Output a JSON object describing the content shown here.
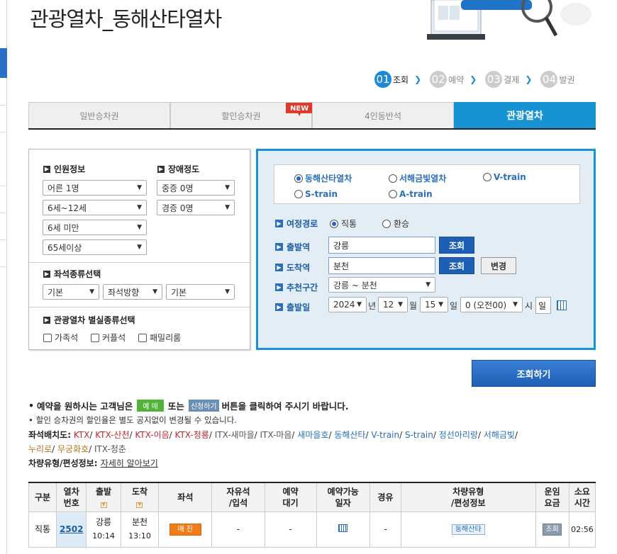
{
  "page_title": "관광열차_동해산타열차",
  "steps": [
    {
      "num": "01",
      "label": "조회",
      "active": true
    },
    {
      "num": "02",
      "label": "예약",
      "active": false
    },
    {
      "num": "03",
      "label": "결제",
      "active": false
    },
    {
      "num": "04",
      "label": "발권",
      "active": false
    }
  ],
  "tabs": [
    {
      "label": "일반승차권",
      "active": false
    },
    {
      "label": "할인승차권",
      "active": false,
      "badge": "NEW"
    },
    {
      "label": "4인동반석",
      "active": false
    },
    {
      "label": "관광열차",
      "active": true
    }
  ],
  "passenger": {
    "title": "인원정보",
    "selects": [
      "어른 1명",
      "6세~12세",
      "6세 미만",
      "65세이상"
    ]
  },
  "disability": {
    "title": "장애정도",
    "selects": [
      "중증 0명",
      "경증 0명"
    ]
  },
  "seat_type": {
    "title": "좌석종류선택",
    "selects": [
      "기본",
      "좌석방향",
      "기본"
    ]
  },
  "room_type": {
    "title": "관광열차 별실종류선택",
    "checkboxes": [
      "가족석",
      "커플석",
      "패밀리룸"
    ]
  },
  "trains": [
    {
      "label": "동해산타열차",
      "checked": true
    },
    {
      "label": "서해금빛열차",
      "checked": false
    },
    {
      "label": "V-train",
      "checked": false
    },
    {
      "label": "S-train",
      "checked": false
    },
    {
      "label": "A-train",
      "checked": false
    }
  ],
  "route": {
    "label": "여정경로",
    "options": [
      {
        "label": "직통",
        "checked": true
      },
      {
        "label": "환승",
        "checked": false
      }
    ]
  },
  "departure": {
    "label": "출발역",
    "value": "강릉",
    "button": "조회"
  },
  "arrival": {
    "label": "도착역",
    "value": "분천",
    "button": "조회",
    "swap_button": "변경"
  },
  "recommend": {
    "label": "추천구간",
    "value": "강릉 ~ 분천"
  },
  "date": {
    "label": "출발일",
    "year": "2024",
    "year_unit": "년",
    "month": "12",
    "month_unit": "월",
    "day": "15",
    "day_unit": "일",
    "hour": "0 (오전00)",
    "hour_unit": "시",
    "weekday": "일"
  },
  "search_button": "조회하기",
  "notes": {
    "line1_pre": "예약을 원하시는 고객님은",
    "line1_badge1": "예 매",
    "line1_mid": "또는",
    "line1_badge2": "신청하기",
    "line1_post": "버튼을 클릭하여 주시기 바랍니다.",
    "line2": "할인 승차권의 할인율은 별도 공지없이 변경될 수 있습니다."
  },
  "seatmap": {
    "label": "좌석배치도:",
    "items": [
      "KTX",
      "KTX-산천",
      "KTX-이음",
      "KTX-청룡",
      "ITX-새마을",
      "ITX-마음",
      "새마을호",
      "동해산타",
      "V-train",
      "S-train",
      "정선아리랑",
      "서해금빛",
      "누리로",
      "무궁화호",
      "ITX-청춘"
    ]
  },
  "vehicle": {
    "label": "차량유형/편성정보:",
    "link": "자세히 알아보기"
  },
  "table": {
    "headers": [
      "구분",
      "열차\n번호",
      "출발",
      "도착",
      "좌석",
      "자유석\n/입석",
      "예약\n대기",
      "예약가능\n일자",
      "경유",
      "차량유형\n/편성정보",
      "운임\n요금",
      "소요\n시간"
    ],
    "rows": [
      {
        "type": "직통",
        "train_no": "2502",
        "dep_station": "강릉",
        "dep_time": "10:14",
        "arr_station": "분천",
        "arr_time": "13:10",
        "seat": "매 진",
        "free": "-",
        "wait": "-",
        "via": "-",
        "vehicle": "동해산타",
        "fare": "조회",
        "duration": "02:56"
      }
    ]
  },
  "colors": {
    "accent": "#1793d4",
    "button": "#1d5fb5",
    "badge_green": "#52b33a",
    "soldout": "#f07d19",
    "new_badge": "#e03a26"
  }
}
